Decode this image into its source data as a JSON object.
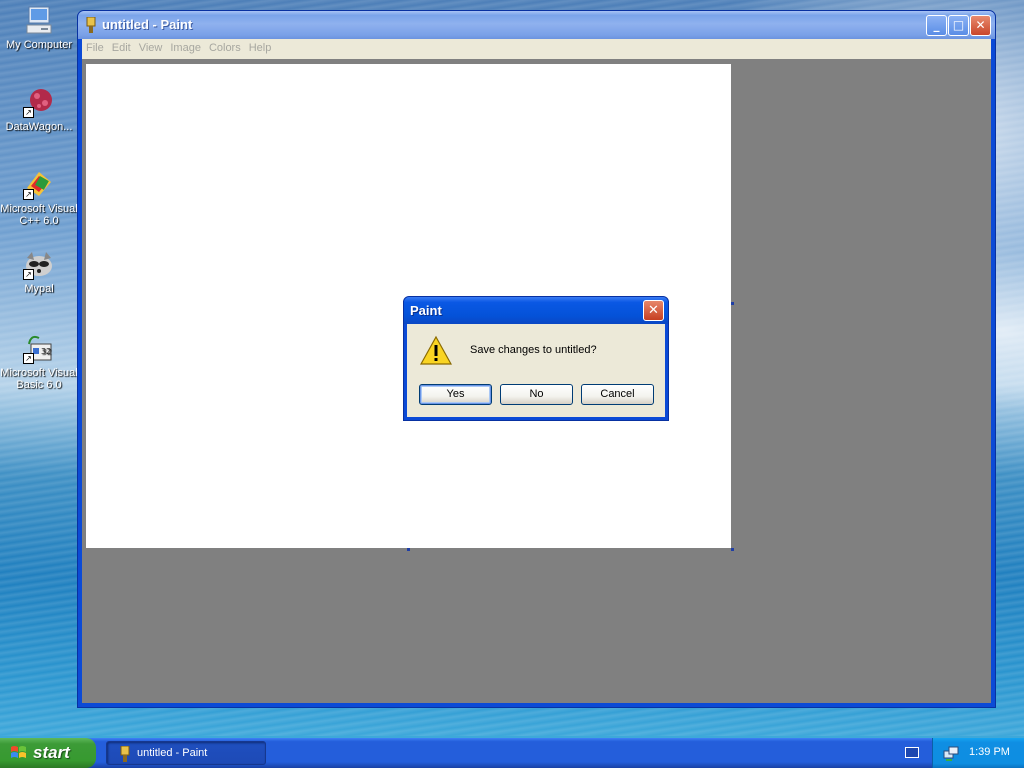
{
  "desktop": {
    "icons": [
      {
        "label_line1": "My Computer",
        "label_line2": "",
        "icon": "my-computer-icon"
      },
      {
        "label_line1": "DataWagon...",
        "label_line2": "",
        "icon": "datawagon-icon"
      },
      {
        "label_line1": "Microsoft Visual",
        "label_line2": "C++ 6.0",
        "icon": "visual-cpp-icon"
      },
      {
        "label_line1": "Mypal",
        "label_line2": "",
        "icon": "mypal-icon"
      },
      {
        "label_line1": "Microsoft Visual",
        "label_line2": "Basic 6.0",
        "icon": "visual-basic-icon"
      }
    ]
  },
  "window": {
    "title": "untitled - Paint",
    "buttons": {
      "minimize": "_",
      "maximize": "□",
      "close": "✕"
    },
    "menu": [
      "File",
      "Edit",
      "View",
      "Image",
      "Colors",
      "Help"
    ],
    "canvas_color": "#ffffff",
    "workspace_color": "#808080"
  },
  "dialog": {
    "title": "Paint",
    "close_glyph": "✕",
    "message": "Save changes to untitled?",
    "icon": "warning-icon",
    "buttons": {
      "yes": "Yes",
      "no": "No",
      "cancel": "Cancel"
    }
  },
  "taskbar": {
    "start_label": "start",
    "task_label": "untitled - Paint",
    "clock": "1:39 PM"
  },
  "colors": {
    "titlebar_active": "#0452d8",
    "titlebar_inactive": "#7aa4ea",
    "start_green": "#3c9b37",
    "taskbar_blue": "#245edb"
  }
}
